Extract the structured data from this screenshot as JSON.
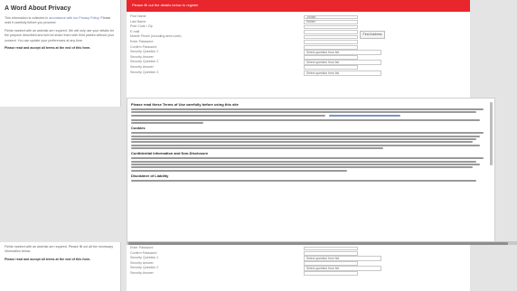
{
  "privacy": {
    "title": "A Word About Privacy",
    "p1_pre": "This information is collected in ",
    "p1_link": "accordance with our Privacy Policy",
    "p1_post": ". Please read it carefully before you proceed.",
    "p2": "Fields marked with an asterisk are required. We will only use your details for the purpose described and will not share them with third parties without your consent. You can update your preferences at any time.",
    "p3": "Please read and accept all terms at the end of this form."
  },
  "privacy_bottom": {
    "p2": "Fields marked with an asterisk are required. Please fill out all the necessary information below.",
    "p3": "Please read and accept all terms at the end of this form."
  },
  "banner": "Please fill out the details below to register",
  "form": {
    "rows": [
      {
        "label": "First Name",
        "kind": "input",
        "value": "Jordan"
      },
      {
        "label": "Last Name",
        "kind": "input",
        "value": "Walker"
      },
      {
        "label": "Post Code / Zip",
        "kind": "input",
        "value": ""
      },
      {
        "label": "E-mail",
        "kind": "input",
        "value": ""
      },
      {
        "label": "Mobile Phone (including area code)",
        "kind": "input",
        "value": ""
      },
      {
        "label": "Enter Password",
        "kind": "input",
        "value": ""
      },
      {
        "label": "Confirm Password",
        "kind": "input",
        "value": ""
      },
      {
        "label": "Security Question 1",
        "kind": "select",
        "value": "Select question from list"
      },
      {
        "label": "Security Answer",
        "kind": "input",
        "value": ""
      },
      {
        "label": "Security Question 2",
        "kind": "select",
        "value": "Select question from list"
      },
      {
        "label": "Security Answer",
        "kind": "input",
        "value": ""
      },
      {
        "label": "Security Question 3",
        "kind": "select",
        "value": "Select question from list"
      }
    ],
    "lookup_label": "Find Address"
  },
  "terms": {
    "heading1": "Please read these Terms of Use carefully before using this site",
    "heading2": "Cookies",
    "heading3": "Confidential Information and Non-Disclosure",
    "heading4": "Disclaimer of Liability"
  },
  "form_bottom": {
    "rows": [
      {
        "label": "Enter Password",
        "kind": "input",
        "value": ""
      },
      {
        "label": "Confirm Password",
        "kind": "input",
        "value": ""
      },
      {
        "label": "Security Question 1",
        "kind": "select",
        "value": "Select question from list"
      },
      {
        "label": "Security Answer",
        "kind": "input",
        "value": ""
      },
      {
        "label": "Security Question 2",
        "kind": "select",
        "value": "Select question from list"
      },
      {
        "label": "Security Answer",
        "kind": "input",
        "value": ""
      }
    ]
  }
}
